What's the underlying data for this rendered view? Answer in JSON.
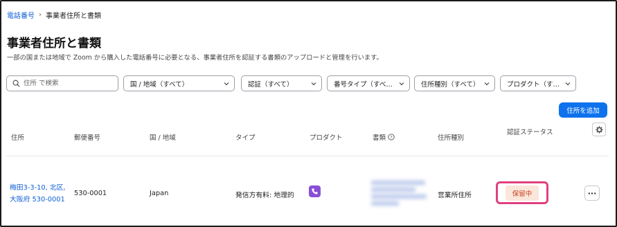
{
  "breadcrumb": {
    "parent": "電話番号",
    "separator": "›",
    "current": "事業者住所と書類"
  },
  "page": {
    "title": "事業者住所と書類",
    "description": "一部の国または地域で Zoom から購入した電話番号に必要となる、事業者住所を認証する書類のアップロードと管理を行います。"
  },
  "filters": {
    "search_placeholder": "住所 で検索",
    "country": "国 / 地域（すべて）",
    "verification": "認証（すべて）",
    "number_type": "番号タイプ（すべ…",
    "address_type": "住所種別（すべて）",
    "product": "プロダクト（す…"
  },
  "actions": {
    "add_address": "住所を追加"
  },
  "table": {
    "headers": {
      "address": "住所",
      "postal": "郵便番号",
      "country": "国 / 地域",
      "type": "タイプ",
      "product": "プロダクト",
      "documents": "書類",
      "address_type": "住所種別",
      "status": "認証ステータス"
    },
    "rows": [
      {
        "address_line1": "梅田3-3-10, 北区,",
        "address_line2": "大阪府 530-0001",
        "postal": "530-0001",
        "country": "Japan",
        "type": "発信方有料: 地理的",
        "product_icon": "phone-icon",
        "address_type": "営業所住所",
        "status": "保留中",
        "more": "···"
      }
    ]
  },
  "colors": {
    "link": "#0e5fd8",
    "primary_button": "#0e72ed",
    "status_text": "#c9461e",
    "status_bg": "#fbe6dc",
    "highlight": "#e0407f",
    "product_icon_bg": "#8a4fd6"
  }
}
